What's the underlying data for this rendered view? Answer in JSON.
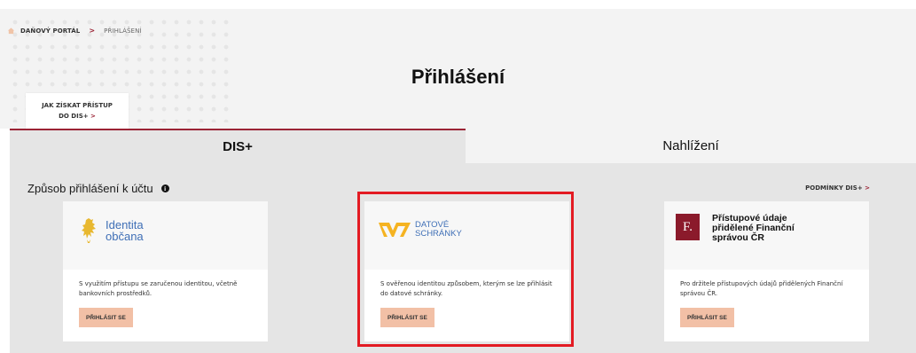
{
  "breadcrumb": {
    "items": [
      "DAŇOVÝ PORTÁL",
      "PŘIHLÁŠENÍ"
    ],
    "separator": ">"
  },
  "page": {
    "title": "Přihlášení"
  },
  "howto": {
    "line1": "JAK ZÍSKAT PŘÍSTUP",
    "line2": "DO DIS+",
    "chevron": ">"
  },
  "tabs": [
    {
      "label": "DIS+",
      "active": true
    },
    {
      "label": "Nahlížení",
      "active": false
    }
  ],
  "section": {
    "title": "Způsob přihlášení k účtu",
    "info_glyph": "i",
    "conditions_link": "PODMÍNKY DIS+",
    "conditions_chevron": ">"
  },
  "cards": [
    {
      "logo": {
        "line1": "Identita",
        "line2": "občana",
        "icon": "lion-emblem-icon"
      },
      "description": "S využitím přístupu se zaručenou identitou, včetně bankovních prostředků.",
      "button": "PŘIHLÁSIT SE"
    },
    {
      "logo": {
        "line1": "DATOVÉ",
        "line2": "SCHRÁNKY",
        "icon": "datove-schranky-icon"
      },
      "description": "S ověřenou identitou způsobem, kterým se lze přihlásit do datové schránky.",
      "button": "PŘIHLÁSIT SE",
      "highlighted": true
    },
    {
      "logo": {
        "glyph": "F.",
        "line1": "Přístupové údaje",
        "line2": "přidělené Finanční",
        "line3": "správou ČR",
        "icon": "financni-sprava-icon"
      },
      "description": "Pro držitele přístupových údajů přidělených Finanční správou ČR.",
      "button": "PŘIHLÁSIT SE"
    }
  ],
  "colors": {
    "accent": "#9b2335",
    "button_bg": "#f2c0a6",
    "highlight": "#e31b23",
    "logo_blue": "#3f6fb6"
  }
}
